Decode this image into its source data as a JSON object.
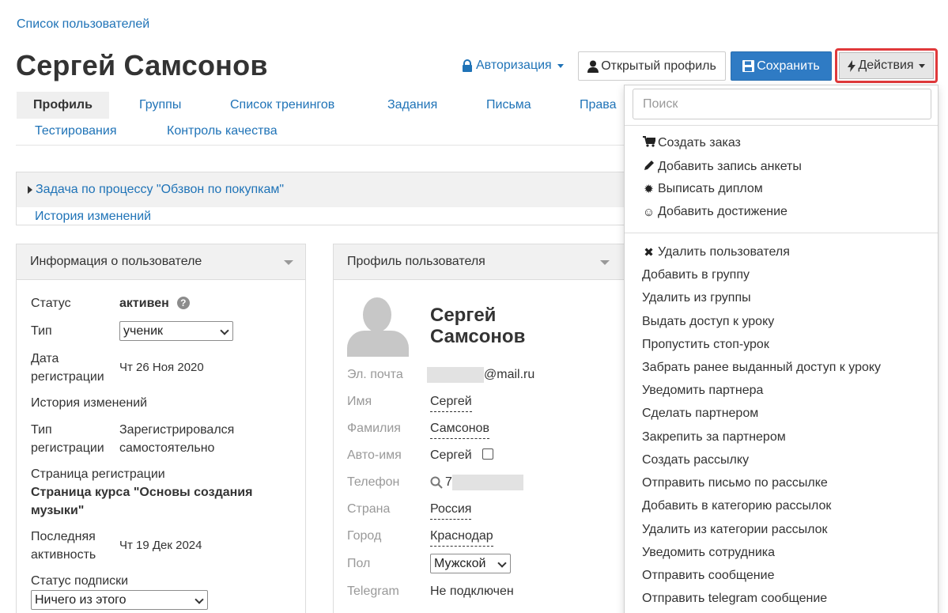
{
  "breadcrumb": "Список пользователей",
  "page_title": "Сергей Самсонов",
  "header": {
    "auth_label": "Авторизация",
    "open_profile_label": "Открытый профиль",
    "save_label": "Сохранить",
    "actions_label": "Действия"
  },
  "tabs": [
    "Профиль",
    "Группы",
    "Список тренингов",
    "Задания",
    "Письма",
    "Права",
    "Тестирования",
    "Контроль качества"
  ],
  "task": {
    "title": "Задача по процессу \"Обзвон по покупкам\"",
    "history_link": "История изменений"
  },
  "user_info": {
    "panel_title": "Информация о пользователе",
    "status_label": "Статус",
    "status_value": "активен",
    "type_label": "Тип",
    "type_value": "ученик",
    "reg_date_label_1": "Дата",
    "reg_date_label_2": "регистрации",
    "reg_date_value": "Чт 26 Ноя 2020",
    "history_link": "История изменений",
    "reg_type_label_1": "Тип",
    "reg_type_label_2": "регистрации",
    "reg_type_value_1": "Зарегистрировался",
    "reg_type_value_2": "самостоятельно",
    "reg_page_label": "Страница регистрации",
    "reg_page_link_1": "Страница курса \"Основы создания",
    "reg_page_link_2": "музыки\"",
    "last_activity_label_1": "Последняя",
    "last_activity_label_2": "активность",
    "last_activity_value": "Чт 19 Дек 2024",
    "subscription_label": "Статус подписки",
    "subscription_value": "Ничего из этого"
  },
  "user_profile": {
    "panel_title": "Профиль пользователя",
    "name_line_1": "Сергей",
    "name_line_2": "Самсонов",
    "email_label": "Эл. почта",
    "email_value": "@mail.ru",
    "first_name_label": "Имя",
    "first_name_value": "Сергей",
    "last_name_label": "Фамилия",
    "last_name_value": "Самсонов",
    "auto_name_label": "Авто-имя",
    "auto_name_value": "Сергей",
    "phone_label": "Телефон",
    "phone_value": "7",
    "country_label": "Страна",
    "country_value": "Россия",
    "city_label": "Город",
    "city_value": "Краснодар",
    "gender_label": "Пол",
    "gender_value": "Мужской",
    "telegram_label": "Telegram",
    "telegram_value": "Не подключен"
  },
  "actions_menu": {
    "search_placeholder": "Поиск",
    "group1": [
      {
        "icon": "cart-icon",
        "label": "Создать заказ"
      },
      {
        "icon": "pencil-icon",
        "label": "Добавить запись анкеты"
      },
      {
        "icon": "certificate-icon",
        "label": "Выписать диплом"
      },
      {
        "icon": "smile-icon",
        "label": "Добавить достижение"
      }
    ],
    "group2": [
      {
        "icon": "remove-icon",
        "label": "Удалить пользователя"
      },
      {
        "label": "Добавить в группу"
      },
      {
        "label": "Удалить из группы"
      },
      {
        "label": "Выдать доступ к уроку"
      },
      {
        "label": "Пропустить стоп-урок"
      },
      {
        "label": "Забрать ранее выданный доступ к уроку"
      },
      {
        "label": "Уведомить партнера"
      },
      {
        "label": "Сделать партнером"
      },
      {
        "label": "Закрепить за партнером"
      },
      {
        "label": "Создать рассылку"
      },
      {
        "label": "Отправить письмо по рассылке"
      },
      {
        "label": "Добавить в категорию рассылок"
      },
      {
        "label": "Удалить из категории рассылок"
      },
      {
        "label": "Уведомить сотрудника"
      },
      {
        "label": "Отправить сообщение"
      },
      {
        "label": "Отправить telegram сообщение"
      }
    ]
  },
  "colors": {
    "link": "#1f73b7",
    "primary": "#2f7bc4",
    "highlight": "#e0393b"
  }
}
